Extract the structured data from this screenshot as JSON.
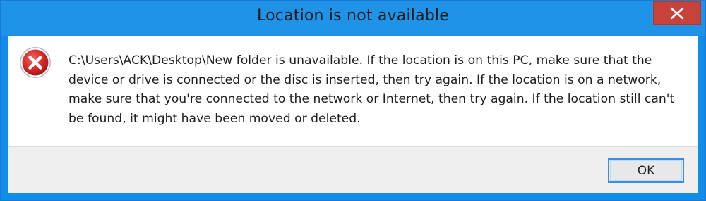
{
  "dialog": {
    "title": "Location is not available",
    "message": "C:\\Users\\ACK\\Desktop\\New folder is unavailable. If the location is on this PC, make sure that the device or drive is connected or the disc is inserted, then try again. If the location is on a network, make sure that you're connected to the network or Internet, then try again. If the location still can't be found, it might have been moved or deleted.",
    "ok_label": "OK",
    "icons": {
      "error": "error-icon",
      "close": "close-icon"
    },
    "colors": {
      "titlebar": "#1e93e8",
      "close_button": "#c7423a",
      "error_red": "#d7282b",
      "ok_border": "#3c8ee0"
    }
  }
}
